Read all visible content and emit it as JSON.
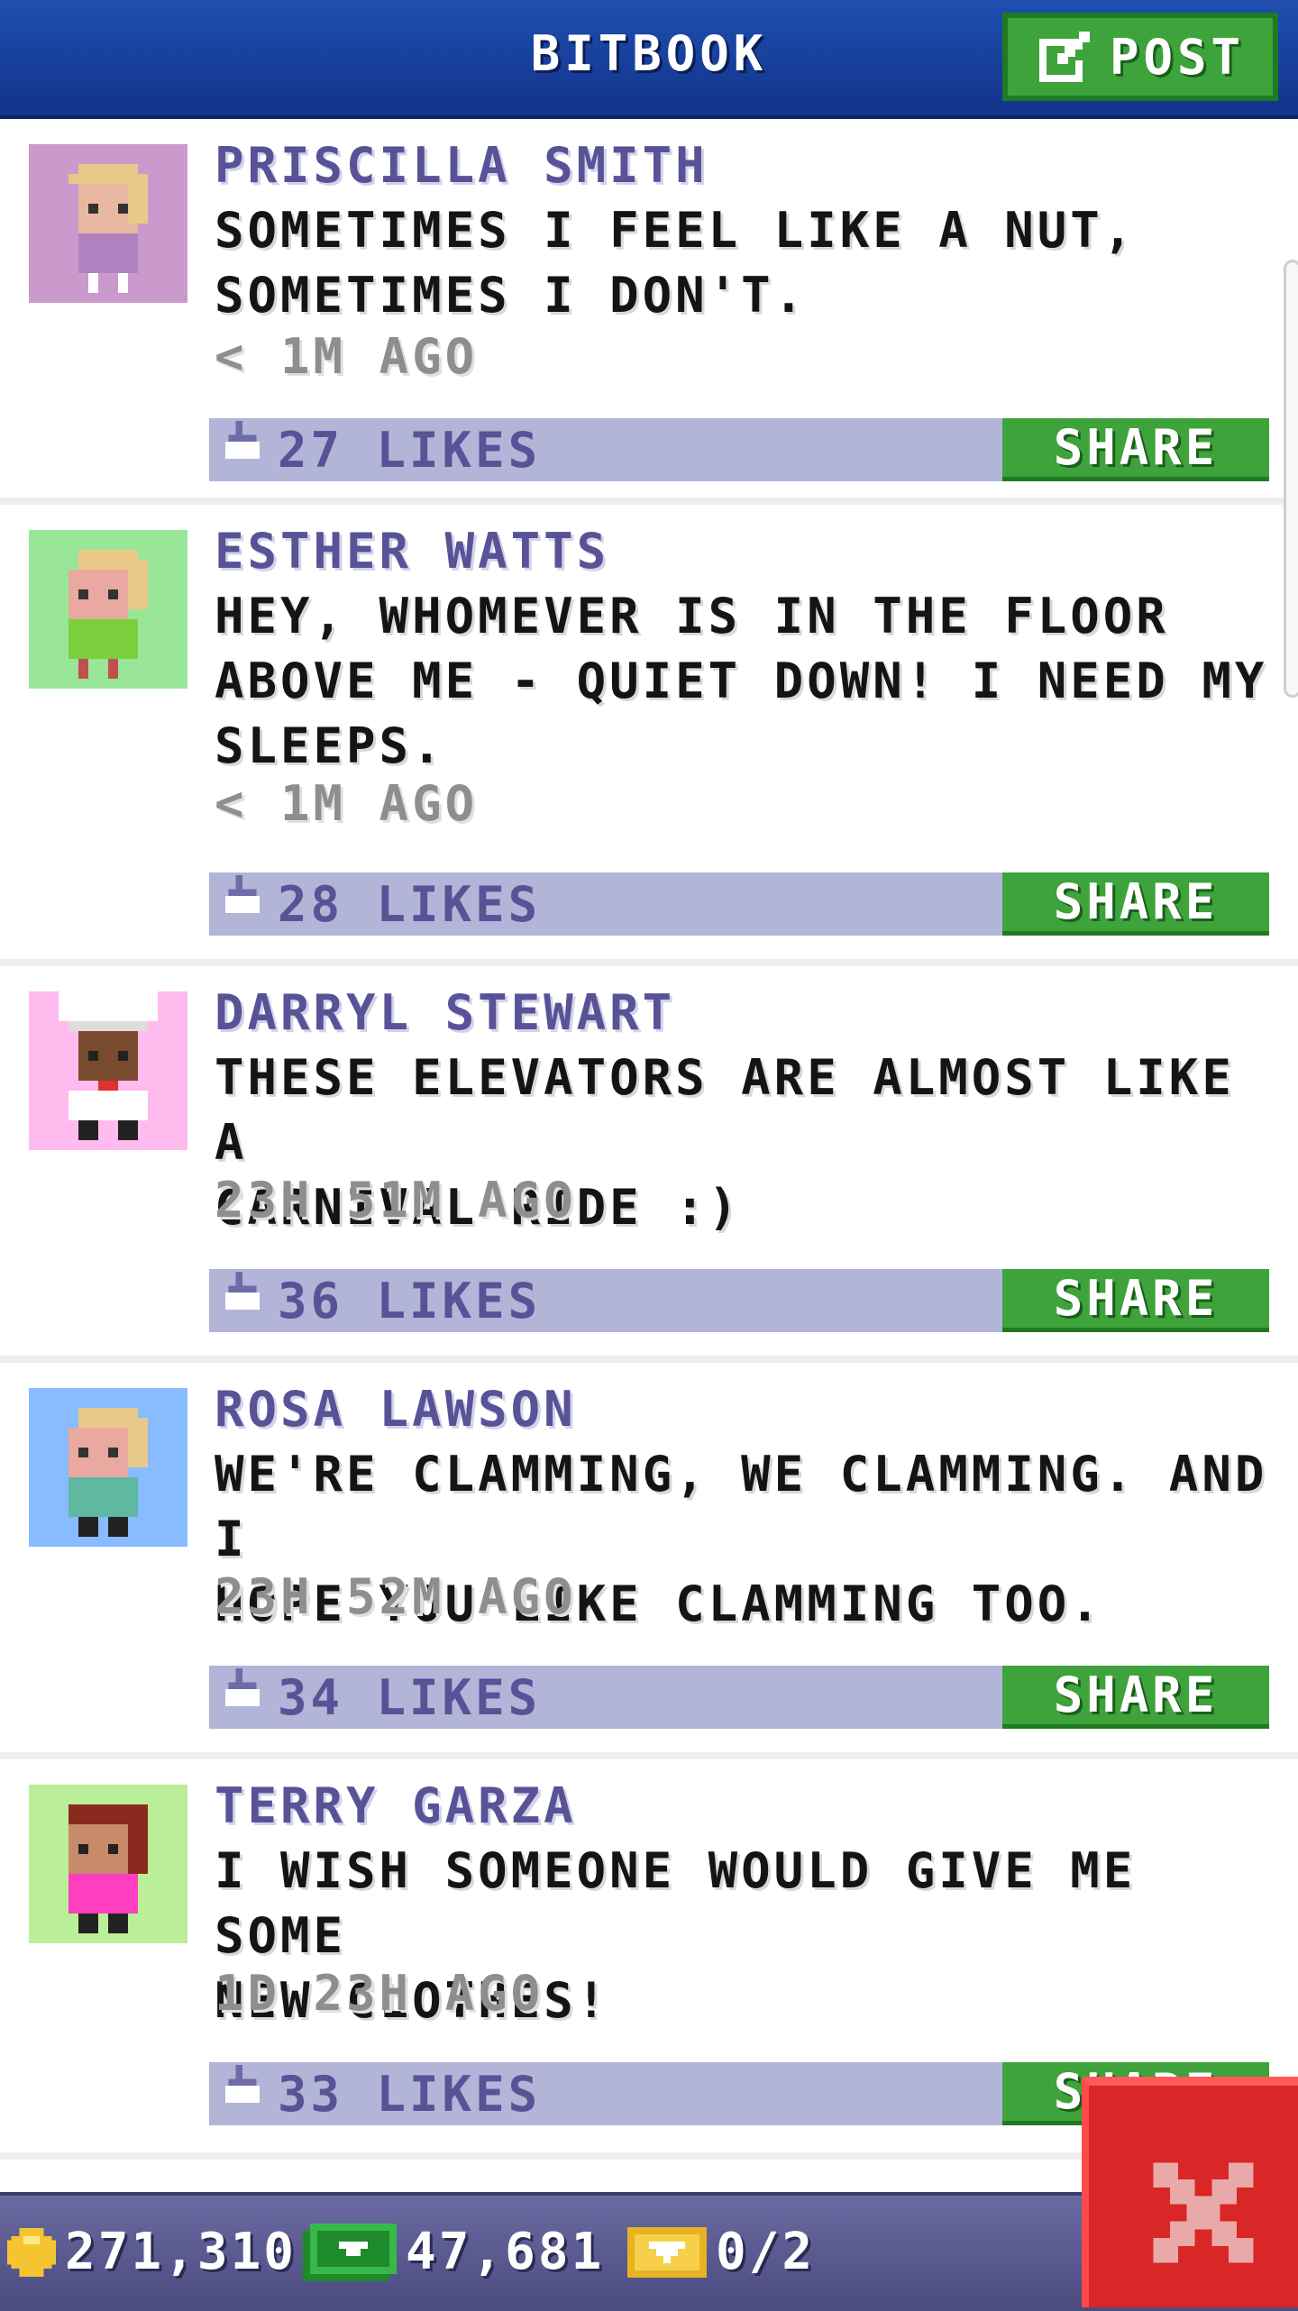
{
  "header": {
    "title": "BITBOOK",
    "post_label": "POST"
  },
  "posts": [
    {
      "author": "PRISCILLA SMITH",
      "lines": [
        "SOMETIMES I FEEL LIKE A NUT,",
        "SOMETIMES I DON'T."
      ],
      "time": "< 1M AGO",
      "likes": "27 LIKES",
      "share_label": "SHARE",
      "avatar_bg": "#cc99cc"
    },
    {
      "author": "ESTHER WATTS",
      "lines": [
        "HEY, WHOMEVER IS IN THE FLOOR",
        "ABOVE ME - QUIET DOWN! I NEED MY",
        "SLEEPS."
      ],
      "time": "< 1M AGO",
      "likes": "28 LIKES",
      "share_label": "SHARE",
      "avatar_bg": "#99e699"
    },
    {
      "author": "DARRYL STEWART",
      "lines": [
        "THESE ELEVATORS ARE ALMOST LIKE A",
        "CARNIVAL RIDE :)"
      ],
      "time": "23H 51M AGO",
      "likes": "36 LIKES",
      "share_label": "SHARE",
      "avatar_bg": "#ffbbee"
    },
    {
      "author": "ROSA LAWSON",
      "lines": [
        "WE'RE CLAMMING, WE CLAMMING. AND I",
        "HOPE YOU LIKE CLAMMING TOO."
      ],
      "time": "23H 52M AGO",
      "likes": "34 LIKES",
      "share_label": "SHARE",
      "avatar_bg": "#88bbff"
    },
    {
      "author": "TERRY GARZA",
      "lines": [
        "I WISH SOMEONE WOULD GIVE ME SOME",
        "NEW CLOTHES!"
      ],
      "time": "1D 23H AGO",
      "likes": "33 LIKES",
      "share_label": "SHARE",
      "avatar_bg": "#bbee99"
    }
  ],
  "footer": {
    "coins": "271,310",
    "bux": "47,681",
    "tickets": "0/2"
  },
  "colors": {
    "header_blue": "#1a44a0",
    "green": "#3da33a",
    "likes_bar": "#b2b4d8",
    "author_purple": "#585296",
    "close_red": "#d92626"
  },
  "icons": [
    "post-edit-icon",
    "thumbs-up-icon",
    "coin-icon",
    "bux-icon",
    "ticket-icon",
    "close-icon"
  ]
}
